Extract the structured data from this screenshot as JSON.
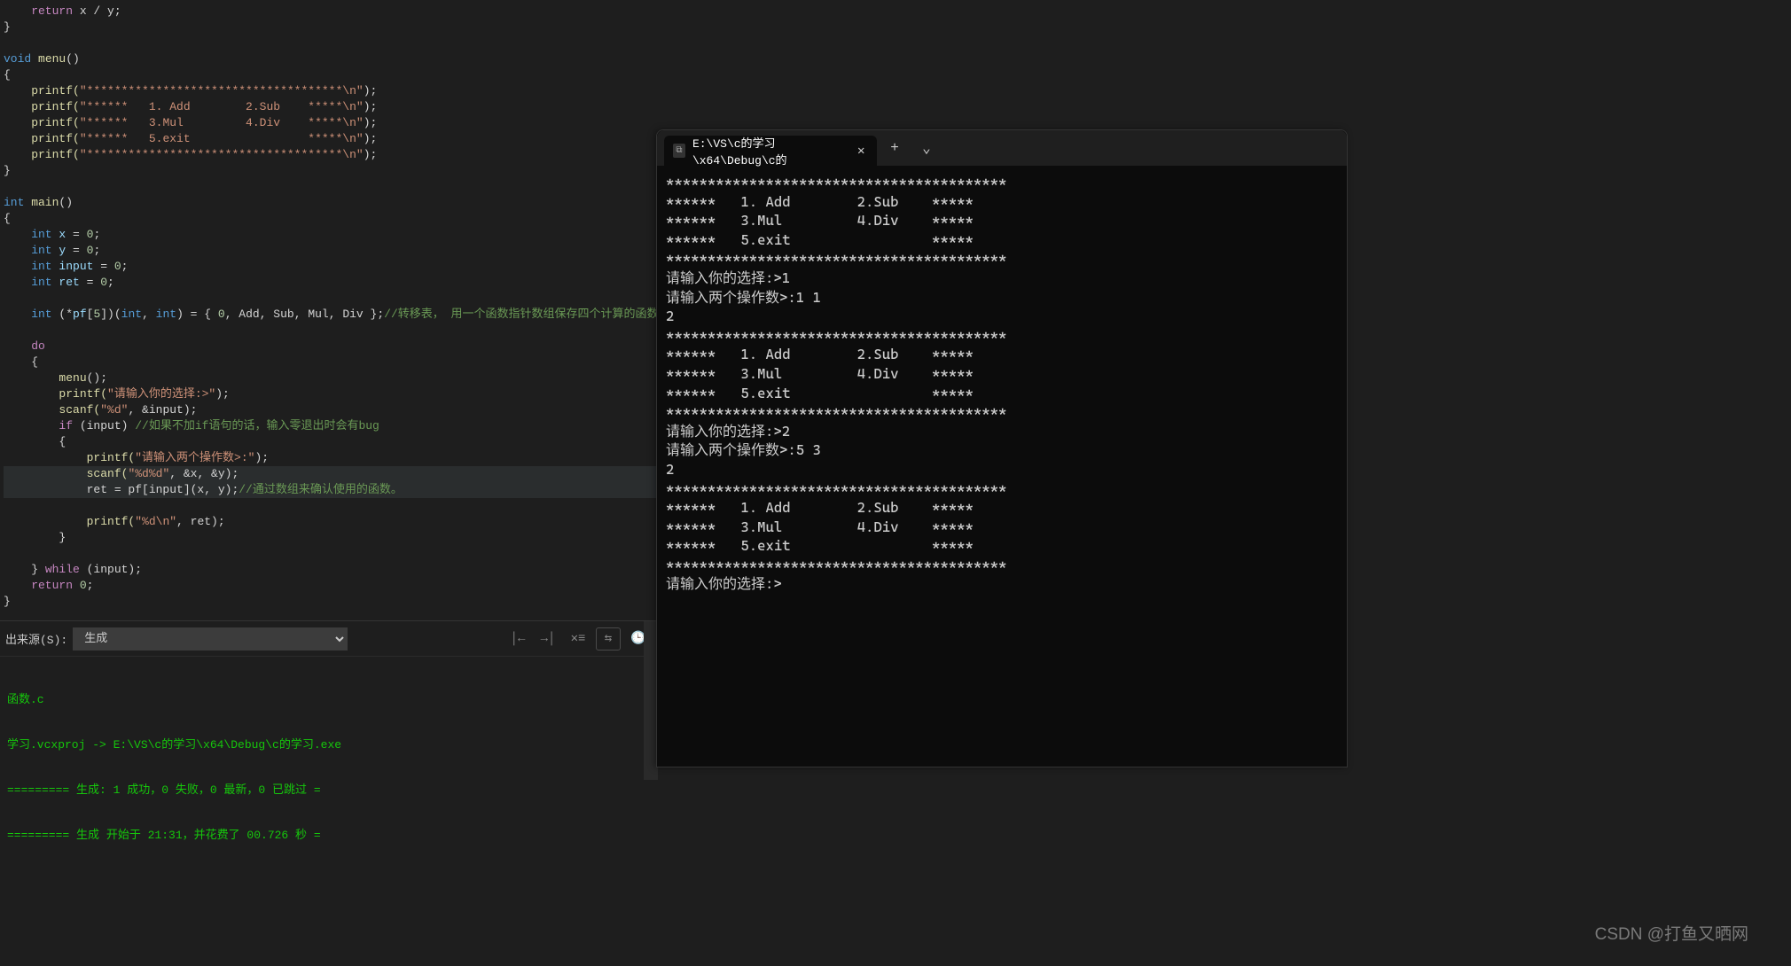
{
  "code": {
    "l01": "    return x / y;",
    "l02": "}",
    "l03": "",
    "l04": "void menu()",
    "l05": "{",
    "l06_a": "    printf(",
    "l06_b": "\"*************************************\\n\"",
    "l06_c": ");",
    "l07_a": "    printf(",
    "l07_b": "\"******   1. Add        2.Sub    *****\\n\"",
    "l07_c": ");",
    "l08_a": "    printf(",
    "l08_b": "\"******   3.Mul         4.Div    *****\\n\"",
    "l08_c": ");",
    "l09_a": "    printf(",
    "l09_b": "\"******   5.exit                 *****\\n\"",
    "l09_c": ");",
    "l10_a": "    printf(",
    "l10_b": "\"*************************************\\n\"",
    "l10_c": ");",
    "l11": "}",
    "l12": "",
    "l13": "int main()",
    "l14": "{",
    "l15": "    int x = 0;",
    "l16": "    int y = 0;",
    "l17": "    int input = 0;",
    "l18": "    int ret = 0;",
    "l19": "",
    "l20_a": "    int (*pf[5])(int, int) = { 0, Add, Sub, Mul, Div };",
    "l20_b": "//转移表， 用一个函数指针数组保存四个计算的函数地址",
    "l21": "",
    "l22": "    do",
    "l23": "    {",
    "l24": "        menu();",
    "l25_a": "        printf(",
    "l25_b": "\"请输入你的选择:>\"",
    "l25_c": ");",
    "l26_a": "        scanf(",
    "l26_b": "\"%d\"",
    "l26_c": ", &input);",
    "l27_a": "        if (input) ",
    "l27_b": "//如果不加if语句的话，输入零退出时会有bug",
    "l28": "        {",
    "l29_a": "            printf(",
    "l29_b": "\"请输入两个操作数>:\"",
    "l29_c": ");",
    "l30_a": "            scanf(",
    "l30_b": "\"%d%d\"",
    "l30_c": ", &x, &y);",
    "l31_a": "            ret = pf[input](x, y);",
    "l31_b": "//通过数组来确认使用的函数。",
    "l32": "",
    "l33_a": "            printf(",
    "l33_b": "\"%d\\n\"",
    "l33_c": ", ret);",
    "l34": "        }",
    "l35": "",
    "l36": "    } while (input);",
    "l37": "    return 0;",
    "l38": "}"
  },
  "bottom": {
    "label": "出来源(S):",
    "selected": "生成",
    "out1": "函数.c",
    "out2": "学习.vcxproj -> E:\\VS\\c的学习\\x64\\Debug\\c的学习.exe",
    "out3": "========= 生成: 1 成功，0 失败，0 最新，0 已跳过 =",
    "out4": "========= 生成 开始于 21:31，并花费了 00.726 秒 ="
  },
  "terminal": {
    "tab": "E:\\VS\\c的学习\\x64\\Debug\\c的",
    "body": "*****************************************\n******   1. Add        2.Sub    *****\n******   3.Mul         4.Div    *****\n******   5.exit                 *****\n*****************************************\n请输入你的选择:>1\n请输入两个操作数>:1 1\n2\n*****************************************\n******   1. Add        2.Sub    *****\n******   3.Mul         4.Div    *****\n******   5.exit                 *****\n*****************************************\n请输入你的选择:>2\n请输入两个操作数>:5 3\n2\n*****************************************\n******   1. Add        2.Sub    *****\n******   3.Mul         4.Div    *****\n******   5.exit                 *****\n*****************************************\n请输入你的选择:>"
  },
  "watermark": "CSDN @打鱼又晒网"
}
